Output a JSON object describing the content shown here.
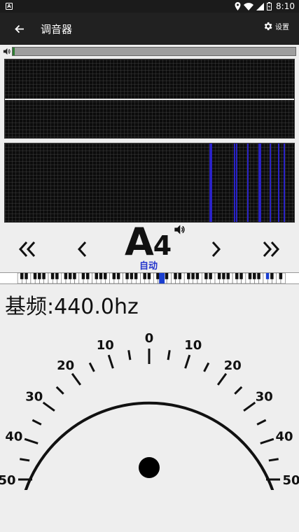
{
  "status_bar": {
    "time": "8:10"
  },
  "app_bar": {
    "title": "调音器",
    "settings_label": "设置"
  },
  "input_level": {
    "fraction": 0.008
  },
  "spectrum": {
    "peak_count": 10
  },
  "tuner": {
    "note": "A",
    "octave": "4",
    "mode_label": "自动",
    "frequency_text": "基频:440.0hz",
    "cents_deviation": 0
  },
  "keyboard": {
    "active_key_index": 40
  },
  "gauge": {
    "tick_labels": [
      "50",
      "40",
      "30",
      "20",
      "10",
      "0",
      "10",
      "20",
      "30",
      "40",
      "50"
    ],
    "range": [
      -50,
      50
    ],
    "needle_value": 0
  },
  "colors": {
    "app_bar": "#212121",
    "status_bar": "#1b1b1b",
    "spectrum_line": "#2a22c8",
    "auto_label": "#2233cc",
    "active_key": "#1a3fd0",
    "level_fill": "#2e7d32"
  },
  "icons": {
    "back": "arrow-left-icon",
    "settings": "gear-icon",
    "speaker": "speaker-icon",
    "double_left": "double-chevron-left-icon",
    "left": "chevron-left-icon",
    "right": "chevron-right-icon",
    "double_right": "double-chevron-right-icon"
  }
}
